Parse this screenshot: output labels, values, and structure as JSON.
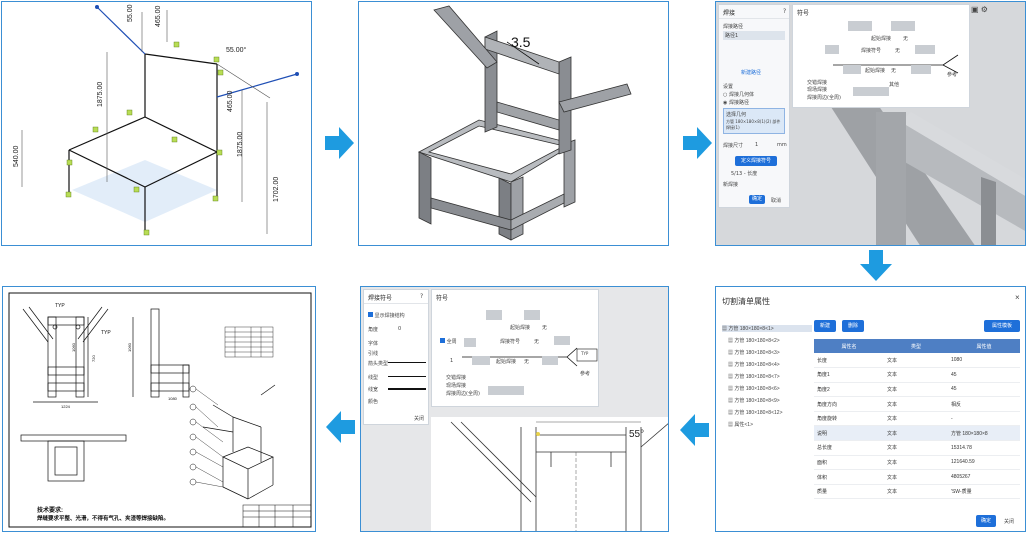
{
  "panel1": {
    "dims": {
      "d1": "55.00",
      "d2": "465.00",
      "d3": "55.00°",
      "d4": "1875.00",
      "d5": "465.00",
      "d6": "1875.00",
      "d7": "540.00",
      "d8": "1702.00"
    }
  },
  "panel2": {
    "weld_label": "3.5"
  },
  "panel3": {
    "left_title": "焊接",
    "right_title": "符号",
    "left_items": [
      "焊接路径",
      "路径1"
    ],
    "new_path": "新建路径",
    "setting": "设置",
    "option1": "焊接几何体",
    "option2": "焊接路径",
    "selected": "选择几何",
    "selected_value": "方管 180×180×8(1)(2) 部件焊接(1)",
    "weld_size_label": "焊接尺寸",
    "weld_size": "1",
    "weld_size_unit": "mm",
    "weld_button": "定义焊接符号",
    "option3": "5/13 - 长度",
    "new_weld": "新焊接",
    "ok": "确定",
    "cancel": "取消",
    "sym_labels": [
      "起始焊接",
      "无",
      "焊接符号",
      "无",
      "起始焊接",
      "无",
      "交错焊接",
      "现场焊接",
      "其他",
      "参考",
      "焊接周边(全周)"
    ]
  },
  "panel4": {
    "title": "切割清单属性",
    "new_btn": "新建",
    "del_btn": "删除",
    "template_btn": "属性模板",
    "tree": [
      "方管 180×180×8<1>",
      "方管 180×180×8<2>",
      "方管 180×180×8<3>",
      "方管 180×180×8<4>",
      "方管 180×180×8<7>",
      "方管 180×180×8<6>",
      "方管 180×180×8<9>",
      "方管 180×180×8<12>",
      "属性<1>"
    ],
    "headers": [
      "属性名",
      "类型",
      "属性值"
    ],
    "rows": [
      {
        "name": "长度",
        "type": "文本",
        "value": "1080"
      },
      {
        "name": "角度1",
        "type": "文本",
        "value": "45"
      },
      {
        "name": "角度2",
        "type": "文本",
        "value": "45"
      },
      {
        "name": "角度方向",
        "type": "文本",
        "value": "相反"
      },
      {
        "name": "角度旋转",
        "type": "文本",
        "value": "-"
      },
      {
        "name": "说明",
        "type": "文本",
        "value": "方管 180×180×8"
      },
      {
        "name": "总长度",
        "type": "文本",
        "value": "15314.78"
      },
      {
        "name": "面积",
        "type": "文本",
        "value": "121640.59"
      },
      {
        "name": "体积",
        "type": "文本",
        "value": "4805267"
      },
      {
        "name": "质量",
        "type": "文本",
        "value": "'SW-质量"
      }
    ],
    "ok": "确定",
    "close": "关闭"
  },
  "panel5": {
    "left_title": "焊接符号",
    "right_title": "符号",
    "show_option": "显示焊接结构",
    "labels": [
      "角度",
      "字体",
      "引线",
      "箭头类型",
      "线型",
      "线宽",
      "颜色"
    ],
    "angle_value": "0",
    "right_labels": [
      "起始焊接",
      "无",
      "全周",
      "焊接符号",
      "无",
      "起始焊接",
      "无",
      "交错焊接",
      "现场焊接",
      "焊接周边(全周)",
      "参考"
    ],
    "size": "1",
    "box_label": "TYP",
    "close": "关闭",
    "angle_dim": "55°"
  },
  "panel6": {
    "typ1": "TYP",
    "typ2": "TYP",
    "dims": [
      "1060",
      "1080",
      "720",
      "1224",
      "1060"
    ],
    "notes_title": "技术要求:",
    "notes_body": "焊缝要求平整、光滑，不得有气孔、夹渣等焊接缺陷。"
  },
  "colors": {
    "border": "#3b8fd4",
    "arrow": "#1e9be0",
    "blue_button": "#1e6fd9",
    "table_header": "#4e7fc4"
  }
}
